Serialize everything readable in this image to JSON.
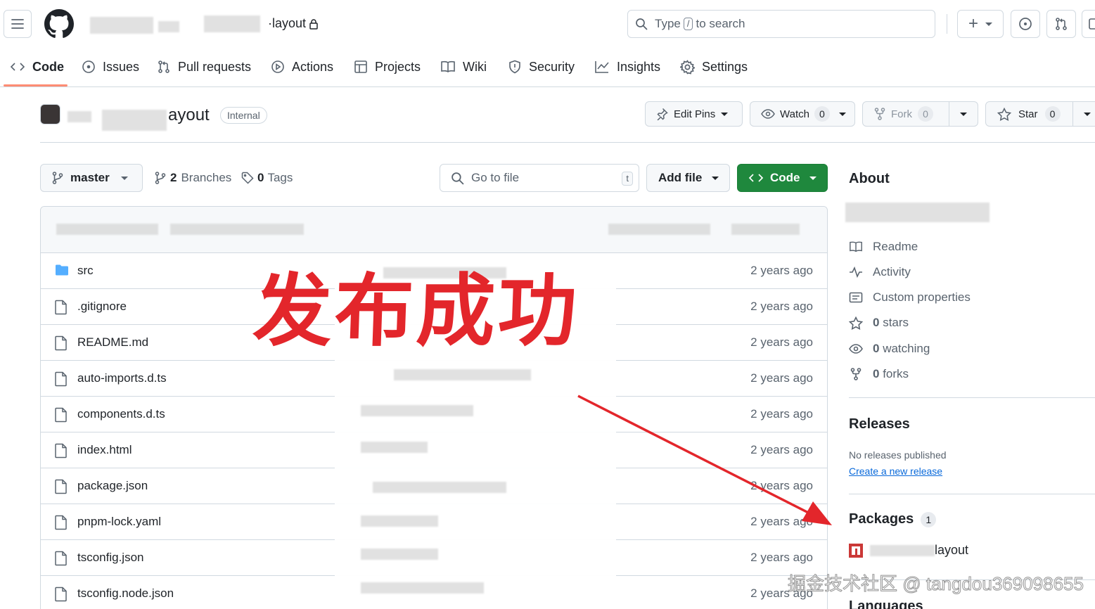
{
  "header": {
    "repo_suffix": "·layout",
    "search_placeholder": "Type",
    "search_key": "/",
    "search_suffix": "to search",
    "plus_label": "+"
  },
  "tabs": [
    {
      "label": "Code",
      "icon": "code-icon"
    },
    {
      "label": "Issues",
      "icon": "issue-icon"
    },
    {
      "label": "Pull requests",
      "icon": "pull-request-icon"
    },
    {
      "label": "Actions",
      "icon": "play-icon"
    },
    {
      "label": "Projects",
      "icon": "table-icon"
    },
    {
      "label": "Wiki",
      "icon": "book-icon"
    },
    {
      "label": "Security",
      "icon": "shield-icon"
    },
    {
      "label": "Insights",
      "icon": "graph-icon"
    },
    {
      "label": "Settings",
      "icon": "gear-icon"
    }
  ],
  "repo": {
    "name_suffix": "ayout",
    "visibility": "Internal",
    "edit_pins": "Edit Pins",
    "watch": "Watch",
    "watch_count": "0",
    "fork": "Fork",
    "fork_count": "0",
    "star": "Star",
    "star_count": "0"
  },
  "toolbar": {
    "branch": "master",
    "branches_count": "2",
    "branches_label": "Branches",
    "tags_count": "0",
    "tags_label": "Tags",
    "goto_placeholder": "Go to file",
    "goto_key": "t",
    "add_file": "Add file",
    "code": "Code"
  },
  "files": [
    {
      "name": "src",
      "type": "folder",
      "time": "2 years ago"
    },
    {
      "name": ".gitignore",
      "type": "file",
      "time": "2 years ago"
    },
    {
      "name": "README.md",
      "type": "file",
      "time": "2 years ago"
    },
    {
      "name": "auto-imports.d.ts",
      "type": "file",
      "time": "2 years ago"
    },
    {
      "name": "components.d.ts",
      "type": "file",
      "time": "2 years ago"
    },
    {
      "name": "index.html",
      "type": "file",
      "time": "2 years ago"
    },
    {
      "name": "package.json",
      "type": "file",
      "time": "2 years ago"
    },
    {
      "name": "pnpm-lock.yaml",
      "type": "file",
      "time": "2 years ago"
    },
    {
      "name": "tsconfig.json",
      "type": "file",
      "time": "2 years ago"
    },
    {
      "name": "tsconfig.node.json",
      "type": "file",
      "time": "2 years ago"
    }
  ],
  "about": {
    "title": "About",
    "readme": "Readme",
    "activity": "Activity",
    "custom_properties": "Custom properties",
    "stars_count": "0",
    "stars_label": "stars",
    "watching_count": "0",
    "watching_label": "watching",
    "forks_count": "0",
    "forks_label": "forks"
  },
  "releases": {
    "title": "Releases",
    "empty": "No releases published",
    "create_link": "Create a new release"
  },
  "packages": {
    "title": "Packages",
    "count": "1",
    "item_suffix": "layout"
  },
  "languages": {
    "title": "Languages"
  },
  "overlay": {
    "headline": "发布成功",
    "watermark": "掘金技术社区 @ tangdou369098655"
  },
  "colors": {
    "accent_green": "#1f883d",
    "overlay_red": "#e3262b",
    "link_blue": "#0969da",
    "folder_blue": "#54aeff",
    "npm_red": "#cb3837"
  }
}
